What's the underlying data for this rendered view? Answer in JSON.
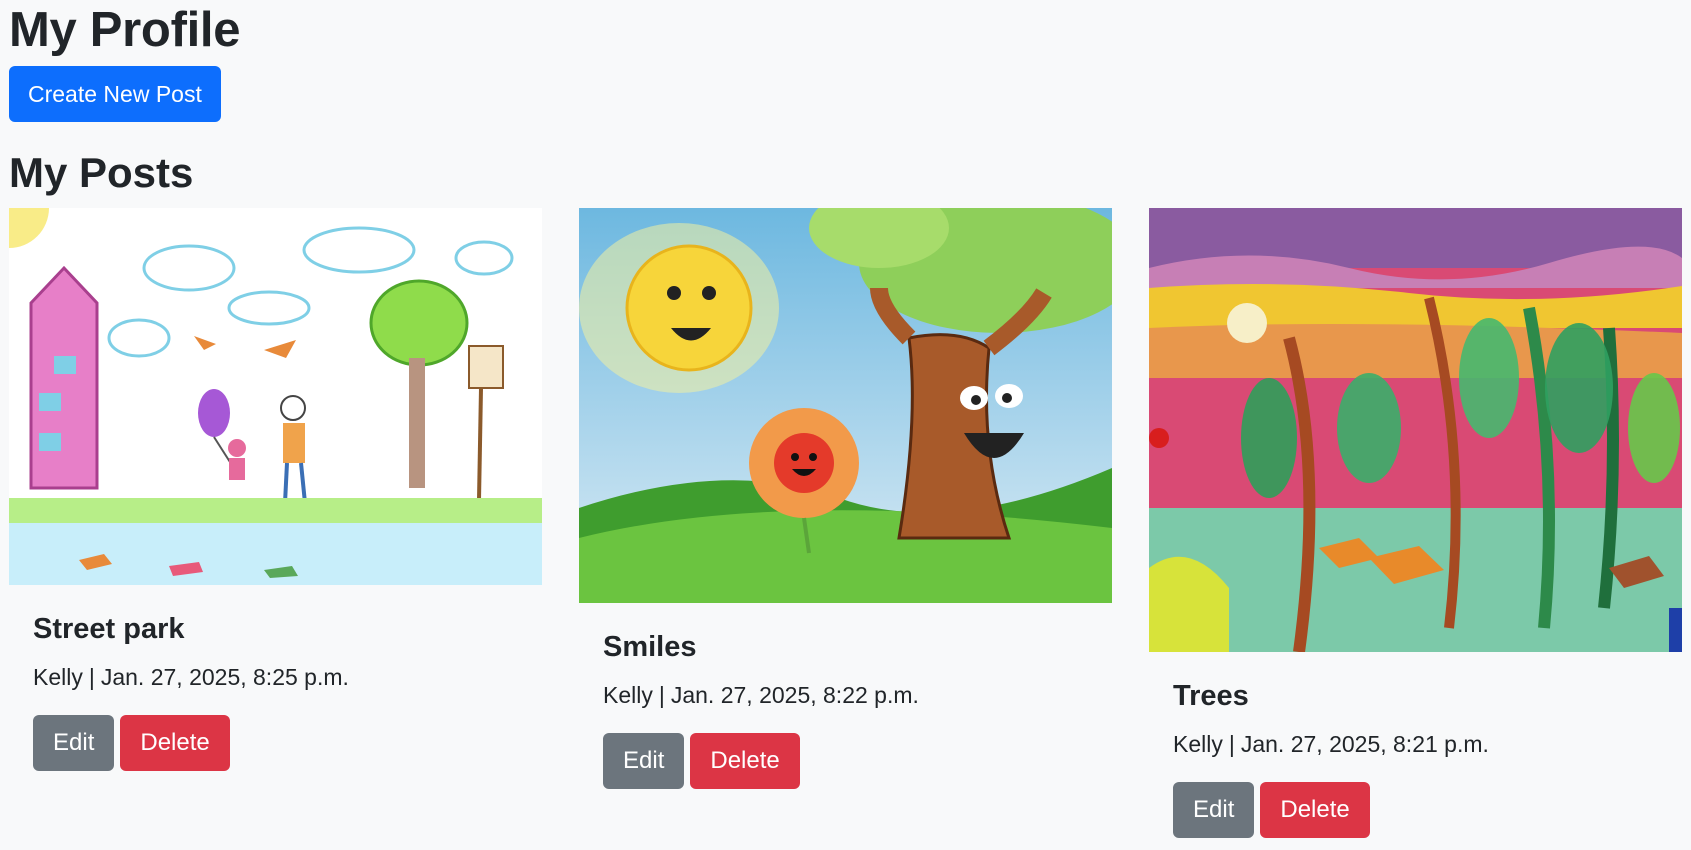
{
  "profile": {
    "title": "My Profile",
    "create_button": "Create New Post"
  },
  "posts_section": {
    "title": "My Posts"
  },
  "posts": [
    {
      "title": "Street park",
      "author": "Kelly",
      "separator": "|",
      "date": "Jan. 27, 2025, 8:25 p.m.",
      "edit_label": "Edit",
      "delete_label": "Delete"
    },
    {
      "title": "Smiles",
      "author": "Kelly",
      "separator": "|",
      "date": "Jan. 27, 2025, 8:22 p.m.",
      "edit_label": "Edit",
      "delete_label": "Delete"
    },
    {
      "title": "Trees",
      "author": "Kelly",
      "separator": "|",
      "date": "Jan. 27, 2025, 8:21 p.m.",
      "edit_label": "Edit",
      "delete_label": "Delete"
    }
  ],
  "colors": {
    "primary": "#0d6efd",
    "secondary": "#6c757d",
    "danger": "#dc3545",
    "background": "#f8f9fa"
  }
}
